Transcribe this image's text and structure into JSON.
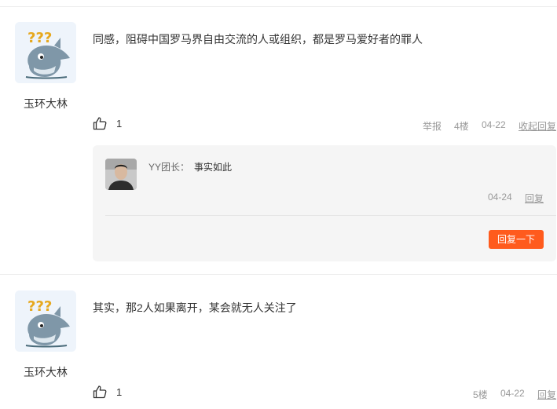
{
  "comments": [
    {
      "author": "玉环大林",
      "content": "同感，阻碍中国罗马界自由交流的人或组织，都是罗马爱好者的罪人",
      "likes": "1",
      "report": "举报",
      "floor": "4楼",
      "date": "04-22",
      "collapse_label": "收起回复",
      "replies": [
        {
          "user": "YY团长：",
          "text": "事实如此",
          "date": "04-24",
          "reply_label": "回复"
        }
      ],
      "reply_button": "回复一下"
    },
    {
      "author": "玉环大林",
      "content": "其实，那2人如果离开，某会就无人关注了",
      "likes": "1",
      "floor": "5楼",
      "date": "04-22",
      "reply_label": "回复"
    }
  ],
  "colors": {
    "accent": "#ff5b1d",
    "panel": "#f5f5f5",
    "muted": "#999999"
  }
}
